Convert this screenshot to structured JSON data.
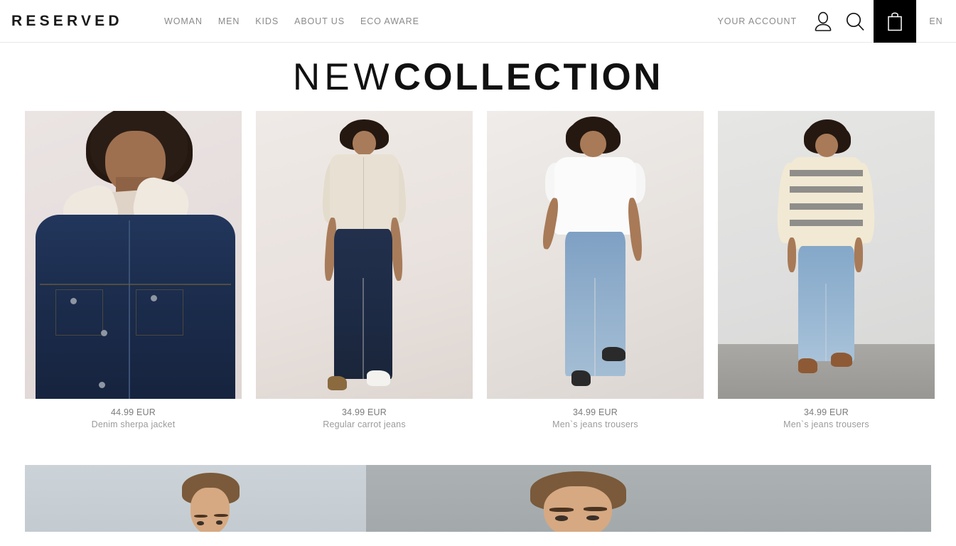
{
  "header": {
    "logo": "RESERVED",
    "nav": [
      {
        "label": "WOMAN"
      },
      {
        "label": "MEN"
      },
      {
        "label": "KIDS"
      },
      {
        "label": "ABOUT US"
      },
      {
        "label": "ECO AWARE"
      }
    ],
    "account_label": "YOUR ACCOUNT",
    "language": "EN",
    "icons": {
      "account": "user-icon",
      "search": "search-icon",
      "cart": "shopping-bag-icon"
    },
    "cart_background": "#000000"
  },
  "title": {
    "light_part": "NEW",
    "bold_part": "COLLECTION"
  },
  "products": [
    {
      "price": "44.99 EUR",
      "name": "Denim sherpa jacket"
    },
    {
      "price": "34.99 EUR",
      "name": "Regular carrot jeans"
    },
    {
      "price": "34.99 EUR",
      "name": "Men`s jeans trousers"
    },
    {
      "price": "34.99 EUR",
      "name": "Men`s jeans trousers"
    }
  ],
  "banner": {
    "panels": [
      {
        "name": "banner-panel-left"
      },
      {
        "name": "banner-panel-right"
      }
    ]
  },
  "colors": {
    "page_background": "#ffffff",
    "nav_text": "#8a8a8a",
    "price_text": "#7b7b7b",
    "product_name_text": "#9b9b9b",
    "title_text": "#111111",
    "header_border": "#e8e8e8"
  }
}
